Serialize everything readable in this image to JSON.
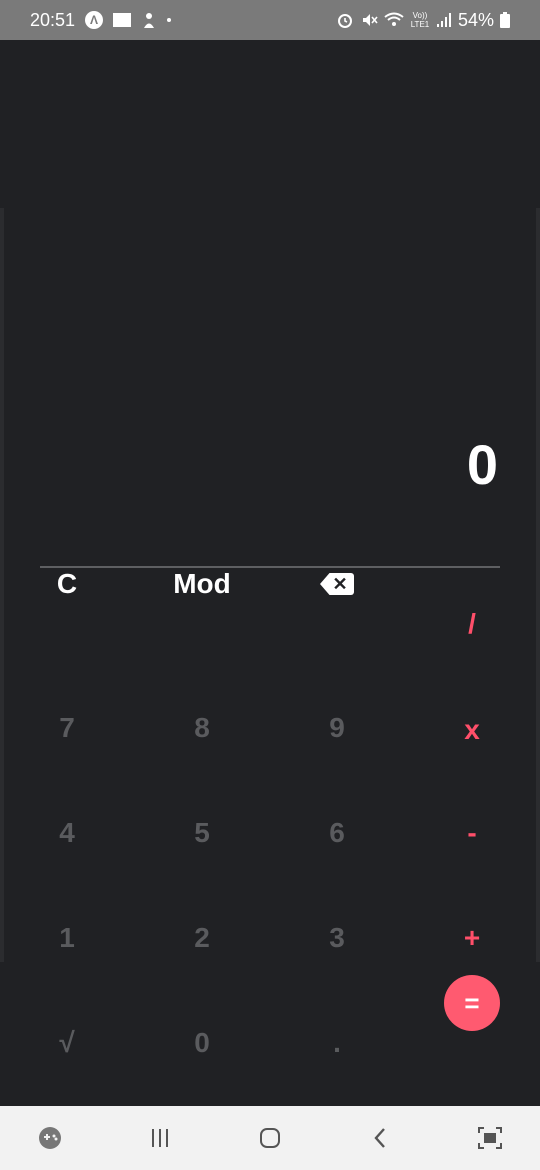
{
  "status_bar": {
    "time": "20:51",
    "left_icons": [
      "app-a-icon",
      "notification-icon",
      "bonus-icon",
      "dot-icon"
    ],
    "network_label": "Vo)) LTE1",
    "battery": "54%"
  },
  "calculator": {
    "display_value": "0",
    "keys": {
      "clear": "C",
      "mod": "Mod",
      "divide": "/",
      "seven": "7",
      "eight": "8",
      "nine": "9",
      "multiply": "x",
      "four": "4",
      "five": "5",
      "six": "6",
      "minus": "-",
      "one": "1",
      "two": "2",
      "three": "3",
      "plus": "+",
      "sqrt": "√",
      "zero": "0",
      "dot": ".",
      "equals": "="
    },
    "accent_color": "#ff5a70"
  },
  "nav_bar": {
    "icons": [
      "game-launcher-icon",
      "recent-apps-icon",
      "home-icon",
      "back-icon",
      "screenshot-icon"
    ]
  }
}
